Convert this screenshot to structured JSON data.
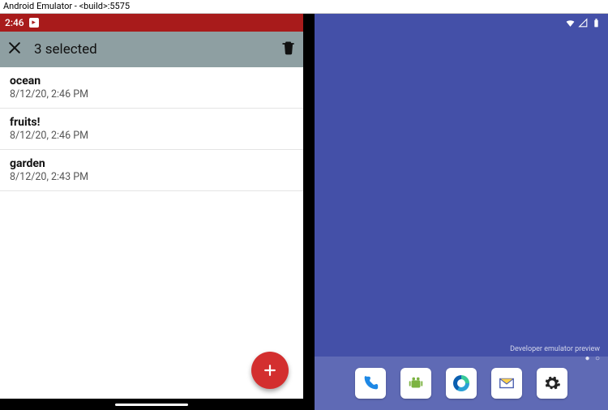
{
  "window_title": "Android Emulator - <build>:5575",
  "left": {
    "status": {
      "time": "2:46"
    },
    "action_bar": {
      "title": "3 selected"
    },
    "notes": [
      {
        "title": "ocean",
        "subtitle": "8/12/20, 2:46 PM"
      },
      {
        "title": "fruits!",
        "subtitle": "8/12/20, 2:46 PM"
      },
      {
        "title": "garden",
        "subtitle": "8/12/20, 2:43 PM"
      }
    ]
  },
  "right": {
    "preview_label": "Developer emulator preview",
    "dock": [
      {
        "name": "phone-app"
      },
      {
        "name": "messages-app"
      },
      {
        "name": "edge-browser-app"
      },
      {
        "name": "mail-app"
      },
      {
        "name": "settings-app"
      }
    ]
  }
}
